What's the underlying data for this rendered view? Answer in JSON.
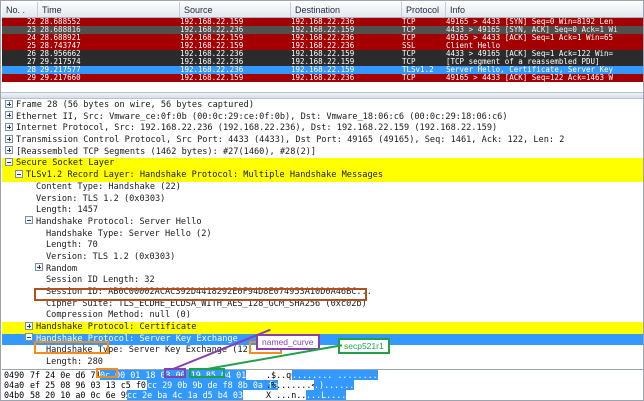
{
  "packet_list": {
    "headers": [
      "No. .",
      "Time",
      "Source",
      "Destination",
      "Protocol",
      "Info"
    ],
    "rows": [
      {
        "no": "22",
        "time": "28.688552",
        "src": "192.168.22.159",
        "dst": "192.168.22.236",
        "proto": "TCP",
        "info": "49165 > 4433 [SYN] Seq=0 Win=8192 Len",
        "bg": "#a40000",
        "fg": "#ffffff"
      },
      {
        "no": "23",
        "time": "28.688816",
        "src": "192.168.22.236",
        "dst": "192.168.22.159",
        "proto": "TCP",
        "info": "4433 > 49165 [SYN, ACK] Seq=0 Ack=1 Wi",
        "bg": "#505050",
        "fg": "#f0f0f0"
      },
      {
        "no": "24",
        "time": "28.688921",
        "src": "192.168.22.159",
        "dst": "192.168.22.236",
        "proto": "TCP",
        "info": "49165 > 4433 [ACK] Seq=1 Ack=1 Win=65",
        "bg": "#a40000",
        "fg": "#ffffff"
      },
      {
        "no": "25",
        "time": "28.743747",
        "src": "192.168.22.159",
        "dst": "192.168.22.236",
        "proto": "SSL",
        "info": "Client Hello",
        "bg": "#a40000",
        "fg": "#ffffff"
      },
      {
        "no": "26",
        "time": "28.956662",
        "src": "192.168.22.236",
        "dst": "192.168.22.159",
        "proto": "TCP",
        "info": "4433 > 49165 [ACK] Seq=1 Ack=122 Win=",
        "bg": "#2b2b2b",
        "fg": "#ffffff"
      },
      {
        "no": "27",
        "time": "29.217574",
        "src": "192.168.22.236",
        "dst": "192.168.22.159",
        "proto": "TCP",
        "info": "[TCP segment of a reassembled PDU]",
        "bg": "#2b2b2b",
        "fg": "#ffffff"
      },
      {
        "no": "28",
        "time": "29.217577",
        "src": "192.168.22.236",
        "dst": "192.168.22.159",
        "proto": "TLSv1.2",
        "info": "Server Hello, Certificate, Server Key",
        "bg": "#3399ff",
        "fg": "#ffffff"
      },
      {
        "no": "29",
        "time": "29.217660",
        "src": "192.168.22.159",
        "dst": "192.168.22.236",
        "proto": "TCP",
        "info": "49165 > 4433 [ACK] Seq=122 Ack=1463 W",
        "bg": "#a40000",
        "fg": "#ffffff"
      }
    ]
  },
  "details": [
    {
      "indent": 0,
      "toggle": "plus",
      "text": "Frame 28 (56 bytes on wire, 56 bytes captured)",
      "style": "frame28"
    },
    {
      "indent": 0,
      "toggle": "plus",
      "text": "Ethernet II, Src: Vmware_ce:0f:0b (00:0c:29:ce:0f:0b), Dst: Vmware_18:06:c6 (00:0c:29:18:06:c6)",
      "style": ""
    },
    {
      "indent": 0,
      "toggle": "plus",
      "text": "Internet Protocol, Src: 192.168.22.236 (192.168.22.236), Dst: 192.168.22.159 (192.168.22.159)",
      "style": ""
    },
    {
      "indent": 0,
      "toggle": "plus",
      "text": "Transmission Control Protocol, Src Port: 4433 (4433), Dst Port: 49165 (49165), Seq: 1461, Ack: 122, Len: 2",
      "style": ""
    },
    {
      "indent": 0,
      "toggle": "plus",
      "text": "[Reassembled TCP Segments (1462 bytes): #27(1460), #28(2)]",
      "style": ""
    },
    {
      "indent": 0,
      "toggle": "minus",
      "text": "Secure Socket Layer",
      "style": "hl"
    },
    {
      "indent": 1,
      "toggle": "minus",
      "text": "TLSv1.2 Record Layer: Handshake Protocol: Multiple Handshake Messages",
      "style": "hl"
    },
    {
      "indent": 2,
      "toggle": "blank",
      "text": "Content Type: Handshake (22)",
      "style": ""
    },
    {
      "indent": 2,
      "toggle": "blank",
      "text": "Version: TLS 1.2 (0x0303)",
      "style": ""
    },
    {
      "indent": 2,
      "toggle": "blank",
      "text": "Length: 1457",
      "style": ""
    },
    {
      "indent": 2,
      "toggle": "minus",
      "text": "Handshake Protocol: Server Hello",
      "style": ""
    },
    {
      "indent": 3,
      "toggle": "blank",
      "text": "Handshake Type: Server Hello (2)",
      "style": ""
    },
    {
      "indent": 3,
      "toggle": "blank",
      "text": "Length: 70",
      "style": ""
    },
    {
      "indent": 3,
      "toggle": "blank",
      "text": "Version: TLS 1.2 (0x0303)",
      "style": ""
    },
    {
      "indent": 3,
      "toggle": "plus",
      "text": "Random",
      "style": ""
    },
    {
      "indent": 3,
      "toggle": "blank",
      "text": "Session ID Length: 32",
      "style": ""
    },
    {
      "indent": 3,
      "toggle": "blank",
      "text": "Session ID: AB0C00002ACAC392D4418292E0F94D8E074953A10D0A46BC...",
      "style": ""
    },
    {
      "indent": 3,
      "toggle": "blank",
      "text": "Cipher Suite: TLS_ECDHE_ECDSA_WITH_AES_128_GCM_SHA256 (0xc02b)",
      "style": ""
    },
    {
      "indent": 3,
      "toggle": "blank",
      "text": "Compression Method: null (0)",
      "style": ""
    },
    {
      "indent": 2,
      "toggle": "plus",
      "text": "Handshake Protocol: Certificate",
      "style": "hl"
    },
    {
      "indent": 2,
      "toggle": "minus",
      "text": "Handshake Protocol: Server Key Exchange",
      "style": "sel"
    },
    {
      "indent": 3,
      "toggle": "blank",
      "text": "Handshake Type: Server Key Exchange (12)",
      "style": ""
    },
    {
      "indent": 3,
      "toggle": "blank",
      "text": "Length: 280",
      "style": ""
    },
    {
      "indent": 2,
      "toggle": "plus",
      "text": "Handshake Protocol: Server Hello Done",
      "style": ""
    }
  ],
  "hex": {
    "rows": [
      {
        "offset": "0490",
        "bytes": "7f 24 0e d6 71 4f",
        "sel_bytes": "0c 00  01 18 03 00 19 85 04 01",
        "ascii": ".$..qO",
        "sel_ascii": "........  ........"
      },
      {
        "offset": "04a0",
        "bytes": "ef 25 08 96 03 13 c5 f0 ab 3c",
        "sel_bytes": "cc 29 0b 9b de f8 8b 0a fe",
        "ascii": ".%.......<",
        "sel_ascii": ".)......"
      },
      {
        "offset": "04b0",
        "bytes": "58 20 10 a0 0c 6e 95 0b",
        "sel_bytes": "cc 2e ba 4c 1a d5 b4 03",
        "ascii": "X ...n..",
        "sel_ascii": "...L...."
      }
    ]
  },
  "annotations": {
    "named_curve": "named_curve",
    "secp521r1": "secp521r1"
  },
  "colors": {
    "highlight_yellow": "#ffff00",
    "selection_blue": "#3399ff",
    "cipher_box": "#b0521d",
    "length_box": "#f58a1f",
    "named_curve_box": "#8a3fb0",
    "secp_box": "#21a04a"
  }
}
